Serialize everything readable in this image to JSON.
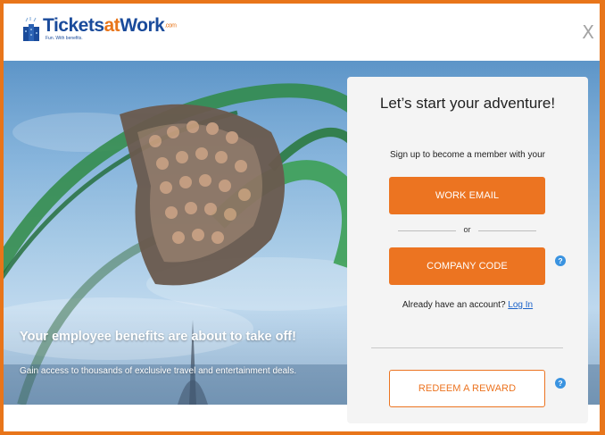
{
  "brand": {
    "name_part1": "Tickets",
    "name_part2": "at",
    "name_part3": "Work",
    "name_suffix": ".com",
    "tagline": "Fun. With benefits."
  },
  "close_label": "X",
  "hero": {
    "title": "Your employee benefits are about to take off!",
    "subtitle": "Gain access to thousands of exclusive travel and entertainment deals."
  },
  "signup": {
    "title": "Let’s start your adventure!",
    "prompt": "Sign up to become a member with your",
    "work_email_label": "WORK EMAIL",
    "or_label": "or",
    "company_code_label": "COMPANY CODE",
    "account_prefix": "Already have an account?",
    "login_label": "Log In",
    "redeem_label": "REDEEM A REWARD",
    "help_glyph": "?"
  },
  "colors": {
    "accent": "#ec7421",
    "brand_blue": "#1a4b9b",
    "help_blue": "#3a93e0",
    "link_blue": "#1a62c9"
  },
  "icons": {
    "logo": "ticket-stack-logo-icon",
    "close": "close-icon",
    "help": "question-circle-icon"
  }
}
